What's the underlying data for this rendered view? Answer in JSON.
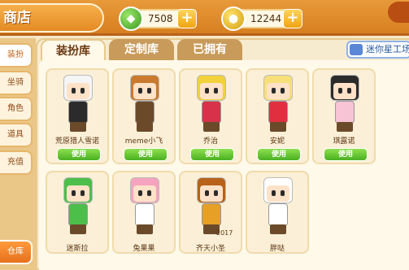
{
  "header": {
    "title": "商店",
    "currencies": [
      {
        "name": "green-gem",
        "value": "7508",
        "color": "#3c9b22"
      },
      {
        "name": "gold-coin",
        "value": "12244",
        "color": "#d4a013"
      }
    ]
  },
  "sidebar": {
    "items": [
      {
        "label": "装扮"
      },
      {
        "label": "坐骑"
      },
      {
        "label": "角色"
      },
      {
        "label": "道具"
      },
      {
        "label": "充值"
      }
    ],
    "bottom": {
      "label": "仓库"
    }
  },
  "tabs": [
    {
      "label": "装扮库",
      "active": true
    },
    {
      "label": "定制库",
      "active": false
    },
    {
      "label": "已拥有",
      "active": false
    }
  ],
  "mini_workshop_button": {
    "label": "迷你星工场"
  },
  "cards": [
    {
      "name": "荒原猎人雪诺",
      "button": "使用",
      "hair": "#f5f5f5",
      "outfit": "#2b2b2b"
    },
    {
      "name": "meme小飞",
      "button": "使用",
      "hair": "#c97a2c",
      "outfit": "#6b4a2a"
    },
    {
      "name": "乔治",
      "button": "使用",
      "hair": "#f2d23a",
      "outfit": "#d8324a"
    },
    {
      "name": "安妮",
      "button": "使用",
      "hair": "#f7e07a",
      "outfit": "#e03040"
    },
    {
      "name": "琪露诺",
      "button": "使用",
      "hair": "#2b2b2b",
      "outfit": "#f6c4d4"
    },
    {
      "name": "迷斯拉",
      "button": "",
      "hair": "#4cbf4a",
      "outfit": "#4cbf4a"
    },
    {
      "name": "兔果果",
      "button": "",
      "hair": "#f5a3bf",
      "outfit": "#ffffff"
    },
    {
      "name": "齐天小圣",
      "button": "",
      "hair": "#b8621a",
      "outfit": "#e6a025",
      "badge": "2017"
    },
    {
      "name": "胖哒",
      "button": "",
      "hair": "#ffffff",
      "outfit": "#ffffff"
    }
  ],
  "colors": {
    "accent": "#e58a24",
    "use_button": "#4ab020"
  }
}
